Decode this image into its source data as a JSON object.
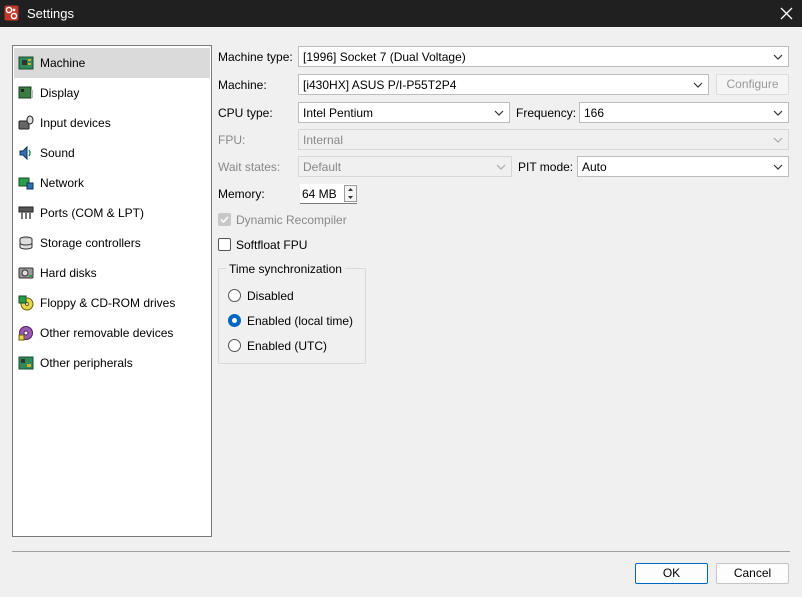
{
  "window": {
    "title": "Settings",
    "app_icon": "86box-icon",
    "close_icon": "close-icon"
  },
  "sidebar": {
    "items": [
      {
        "label": "Machine",
        "icon": "machine-icon",
        "selected": true
      },
      {
        "label": "Display",
        "icon": "display-icon"
      },
      {
        "label": "Input devices",
        "icon": "input-devices-icon"
      },
      {
        "label": "Sound",
        "icon": "sound-icon"
      },
      {
        "label": "Network",
        "icon": "network-icon"
      },
      {
        "label": "Ports (COM & LPT)",
        "icon": "ports-icon"
      },
      {
        "label": "Storage controllers",
        "icon": "storage-controllers-icon"
      },
      {
        "label": "Hard disks",
        "icon": "hard-disks-icon"
      },
      {
        "label": "Floppy & CD-ROM drives",
        "icon": "floppy-cdrom-icon"
      },
      {
        "label": "Other removable devices",
        "icon": "removable-devices-icon"
      },
      {
        "label": "Other peripherals",
        "icon": "peripherals-icon"
      }
    ]
  },
  "machine": {
    "machine_type": {
      "label": "Machine type:",
      "value": "[1996] Socket 7 (Dual Voltage)"
    },
    "machine": {
      "label": "Machine:",
      "value": "[i430HX] ASUS P/I-P55T2P4"
    },
    "configure_label": "Configure",
    "cpu_type": {
      "label": "CPU type:",
      "value": "Intel Pentium"
    },
    "frequency": {
      "label": "Frequency:",
      "value": "166"
    },
    "fpu": {
      "label": "FPU:",
      "value": "Internal"
    },
    "wait_states": {
      "label": "Wait states:",
      "value": "Default"
    },
    "pit_mode": {
      "label": "PIT mode:",
      "value": "Auto"
    },
    "memory": {
      "label": "Memory:",
      "value": "64 MB"
    },
    "dynamic_recompiler": {
      "label": "Dynamic Recompiler",
      "checked": true,
      "enabled": false
    },
    "softfloat_fpu": {
      "label": "Softfloat FPU",
      "checked": false
    },
    "time_sync": {
      "title": "Time synchronization",
      "options": [
        {
          "label": "Disabled",
          "selected": false
        },
        {
          "label": "Enabled (local time)",
          "selected": true
        },
        {
          "label": "Enabled (UTC)",
          "selected": false
        }
      ]
    }
  },
  "footer": {
    "ok_label": "OK",
    "cancel_label": "Cancel"
  },
  "colors": {
    "titlebar": "#202020",
    "accent": "#0067c0",
    "selected_item": "#dadada",
    "background": "#f0f0f0"
  }
}
